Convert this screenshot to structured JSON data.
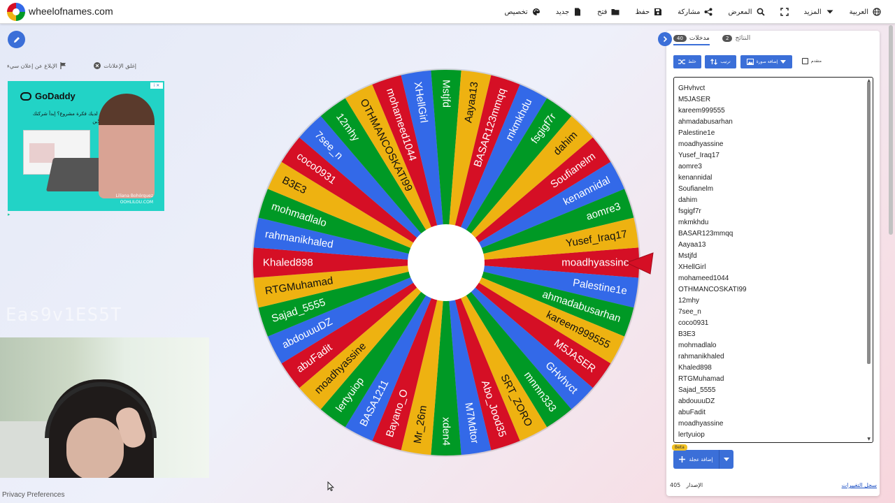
{
  "header": {
    "site_title": "wheelofnames.com",
    "nav": [
      {
        "id": "language",
        "label": "العربية",
        "icon": "globe-icon"
      },
      {
        "id": "more",
        "label": "المزيد",
        "icon": "caret-down-icon"
      },
      {
        "id": "fullscreen",
        "label": "",
        "icon": "fullscreen-icon"
      },
      {
        "id": "gallery",
        "label": "المعرض",
        "icon": "search-icon"
      },
      {
        "id": "share",
        "label": "مشاركة",
        "icon": "share-icon"
      },
      {
        "id": "save",
        "label": "حفظ",
        "icon": "save-icon"
      },
      {
        "id": "open",
        "label": "فتح",
        "icon": "folder-icon"
      },
      {
        "id": "new",
        "label": "جديد",
        "icon": "file-icon"
      },
      {
        "id": "customize",
        "label": "تخصيص",
        "icon": "palette-icon"
      }
    ]
  },
  "ad": {
    "close_label": "إغلق الإعلانات",
    "report_label": "الإبلاغ عن إعلان سيء",
    "brand": "GoDaddy",
    "text": "هل لديك فكرة مشروع؟ إبدأ شركتك اونلاين",
    "caption_line1": "Liliana Bohórquez",
    "caption_line2": "OOHLILOU.COM"
  },
  "footer": {
    "privacy": "Privacy Preferences"
  },
  "wheel": {
    "colors": [
      "#3369e8",
      "#009925",
      "#eeb211",
      "#d50f25"
    ],
    "pointer_color": "#d50f25",
    "pointer_target": "moadhyassine"
  },
  "panel": {
    "tab_entries_label": "مدخلات",
    "tab_entries_count": "40",
    "tab_results_label": "النتائج",
    "tab_results_count": "2",
    "shuffle_label": "خلط",
    "sort_label": "ترتيب",
    "add_image_label": "إضافة صورة",
    "advanced_label": "متقدم",
    "add_wheel_label": "إضافة عجلة",
    "beta_label": "Beta",
    "version_label": "الإصدار",
    "version_number": "405",
    "changelog_label": "سجل التغييرات",
    "entries": [
      "GHvhvct",
      "M5JASER",
      "kareem999555",
      "ahmadabusarhan",
      "Palestine1e",
      "moadhyassine",
      "Yusef_Iraq17",
      "aomre3",
      "kenannidal",
      "Soufianelm",
      "dahim",
      "fsgigf7r",
      "mkmkhdu",
      "BASAR123mmqq",
      "Aayaa13",
      "Mstjfd",
      "XHellGirl",
      "mohameed1044",
      "OTHMANCOSKATI99",
      "12mhy",
      "7see_n",
      "coco0931",
      "B3E3",
      "mohmadlalo",
      "rahmanikhaled",
      "Khaled898",
      "RTGMuhamad",
      "Sajad_5555",
      "abdouuuDZ",
      "abuFadit",
      "moadhyassine",
      "lertyuiop"
    ]
  },
  "wheel_sectors": [
    "moadhyassine",
    "Palestine1e",
    "ahmadabusarhan",
    "kareem999555",
    "M5JASER",
    "GHvhvct",
    "mnmn333",
    "SRT_ZORO",
    "Abo_Jood35",
    "M7Mdtor",
    "xden4",
    "Mr_26m",
    "Bayano_O",
    "BASA1211",
    "lertyuiop",
    "moadhyassine",
    "abuFadit",
    "abdouuuDZ",
    "Sajad_5555",
    "RTGMuhamad",
    "Khaled898",
    "rahmanikhaled",
    "mohmadlalo",
    "B3E3",
    "coco0931",
    "7see_n",
    "12mhy",
    "OTHMANCOSKATI99",
    "mohameed1044",
    "XHellGirl",
    "Mstjfd",
    "Aayaa13",
    "BASAR123mmqq",
    "mkmkhdu",
    "fsgigf7r",
    "dahim",
    "Soufianelm",
    "kenannidal",
    "aomre3",
    "Yusef_Iraq17"
  ],
  "overlay_text": "Eas9v1ES5T"
}
